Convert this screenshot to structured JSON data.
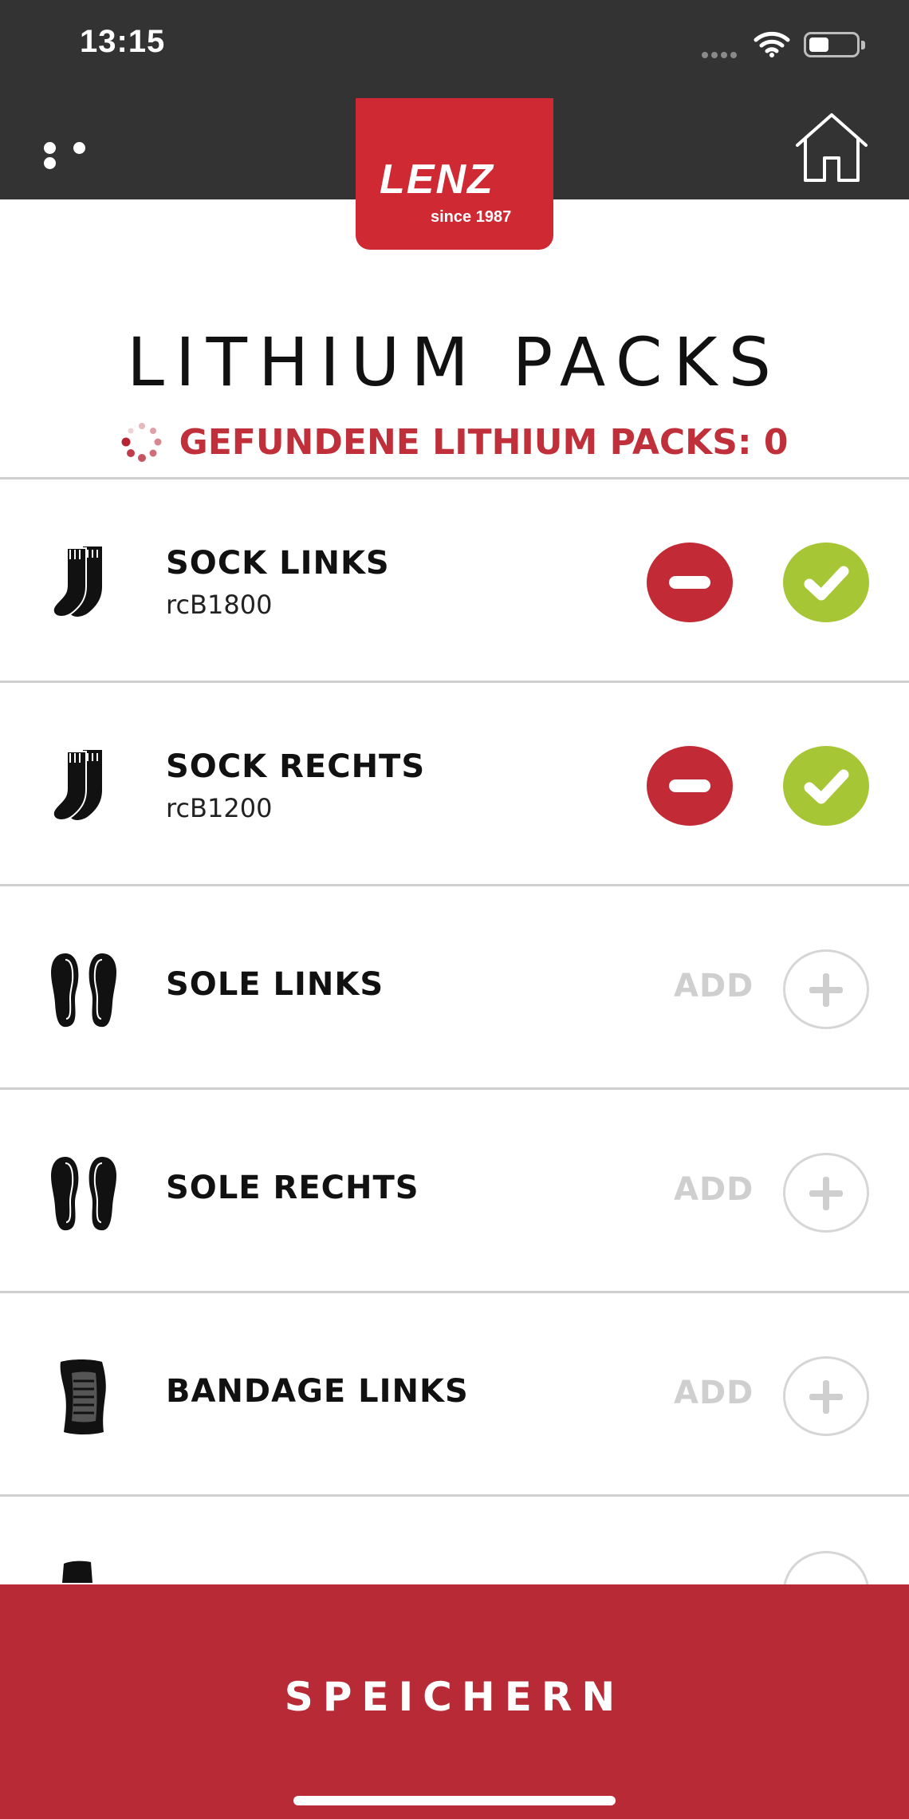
{
  "status_bar": {
    "time": "13:15"
  },
  "header": {
    "logo_text": "LENZ",
    "logo_subtitle": "since 1987"
  },
  "page": {
    "title": "LITHIUM PACKS",
    "found_text": "GEFUNDENE LITHIUM PACKS: 0"
  },
  "colors": {
    "brand_red": "#c22a36",
    "confirm_green": "#a7c636",
    "header_dark": "#333333"
  },
  "items": [
    {
      "icon": "sock-icon",
      "name": "SOCK LINKS",
      "serial": "rcB1800",
      "state": "assigned"
    },
    {
      "icon": "sock-icon",
      "name": "SOCK RECHTS",
      "serial": "rcB1200",
      "state": "assigned"
    },
    {
      "icon": "sole-icon",
      "name": "SOLE LINKS",
      "add_label": "ADD",
      "state": "empty"
    },
    {
      "icon": "sole-icon",
      "name": "SOLE RECHTS",
      "add_label": "ADD",
      "state": "empty"
    },
    {
      "icon": "bandage-icon",
      "name": "BANDAGE LINKS",
      "add_label": "ADD",
      "state": "empty"
    }
  ],
  "footer": {
    "save_label": "SPEICHERN"
  }
}
